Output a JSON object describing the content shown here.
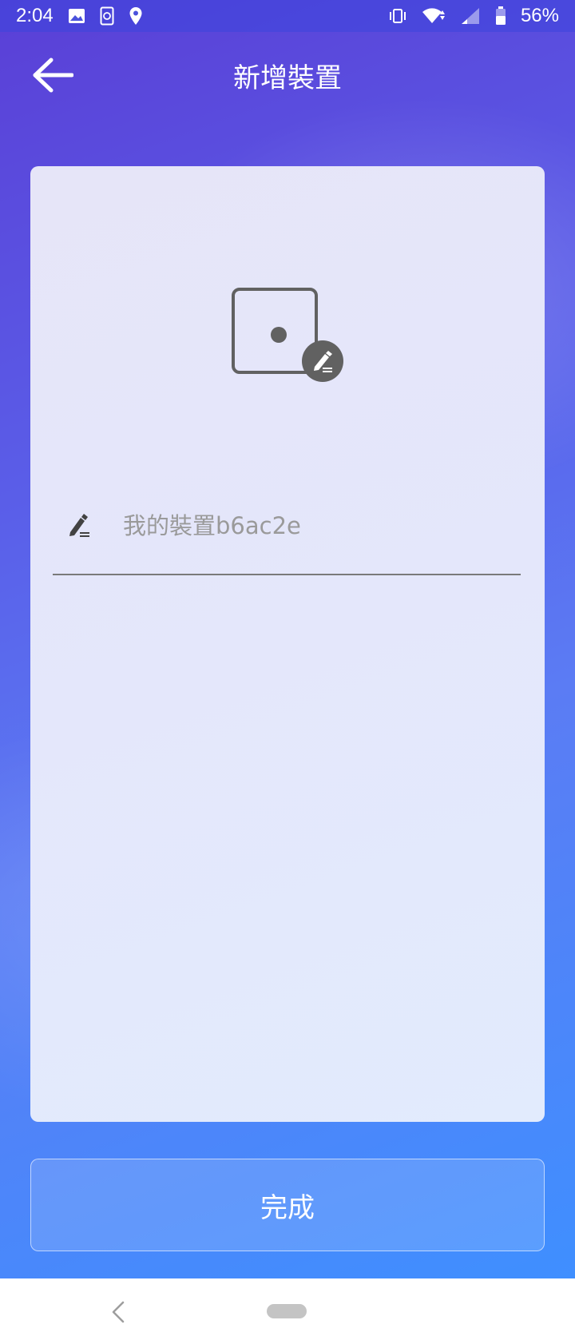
{
  "status_bar": {
    "time": "2:04",
    "battery_percent": "56%",
    "icons_left": [
      "image-icon",
      "sync-icon",
      "location-pin-icon"
    ],
    "icons_right": [
      "vibrate-icon",
      "wifi-icon",
      "signal-icon",
      "battery-icon"
    ]
  },
  "app_bar": {
    "title": "新增裝置",
    "back_icon": "arrow-left-icon"
  },
  "card": {
    "device_icon": "device-icon",
    "edit_badge_icon": "pencil-icon",
    "name_field": {
      "placeholder": "我的裝置b6ac2e",
      "value": "",
      "icon": "edit-icon"
    }
  },
  "actions": {
    "done_label": "完成"
  },
  "nav_bar": {
    "back_icon": "nav-back-icon",
    "home_icon": "home-pill-icon"
  },
  "colors": {
    "gradient_start": "#5a3fd6",
    "gradient_end": "#3f8fff",
    "card_bg": "#e4e7fb",
    "icon_gray": "#616161",
    "placeholder_gray": "#9a9a9a"
  }
}
